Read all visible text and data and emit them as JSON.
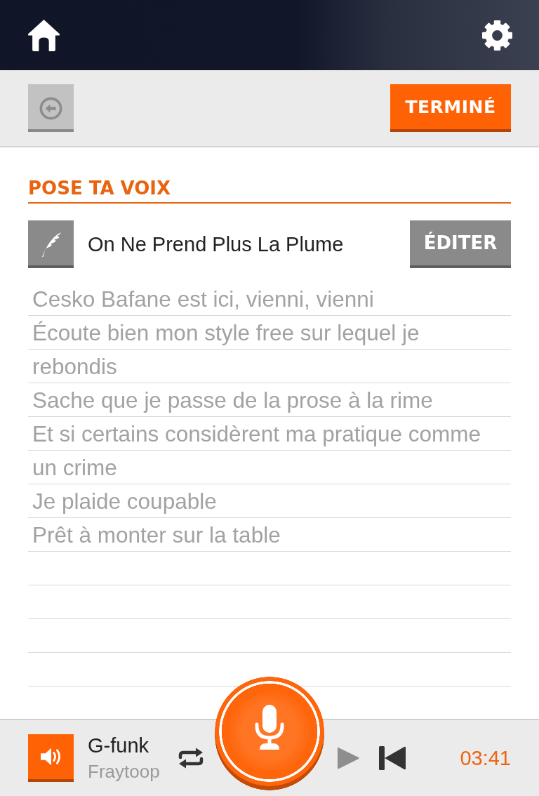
{
  "toolbar": {
    "done_button": "TERMINÉ"
  },
  "section": {
    "title": "POSE TA VOIX"
  },
  "song": {
    "title": "On Ne Prend Plus La Plume",
    "edit_button": "ÉDITER"
  },
  "lyrics": [
    "Cesko Bafane est ici, vienni, vienni",
    "Écoute bien mon style free sur lequel je rebondis",
    "Sache que je passe de la prose à la rime",
    "Et si certains considèrent ma pratique comme un crime",
    "Je plaide coupable",
    "Prêt à monter sur la table"
  ],
  "player": {
    "track": "G-funk",
    "artist": "Fraytoop",
    "time": "03:41",
    "play_disabled": true
  }
}
